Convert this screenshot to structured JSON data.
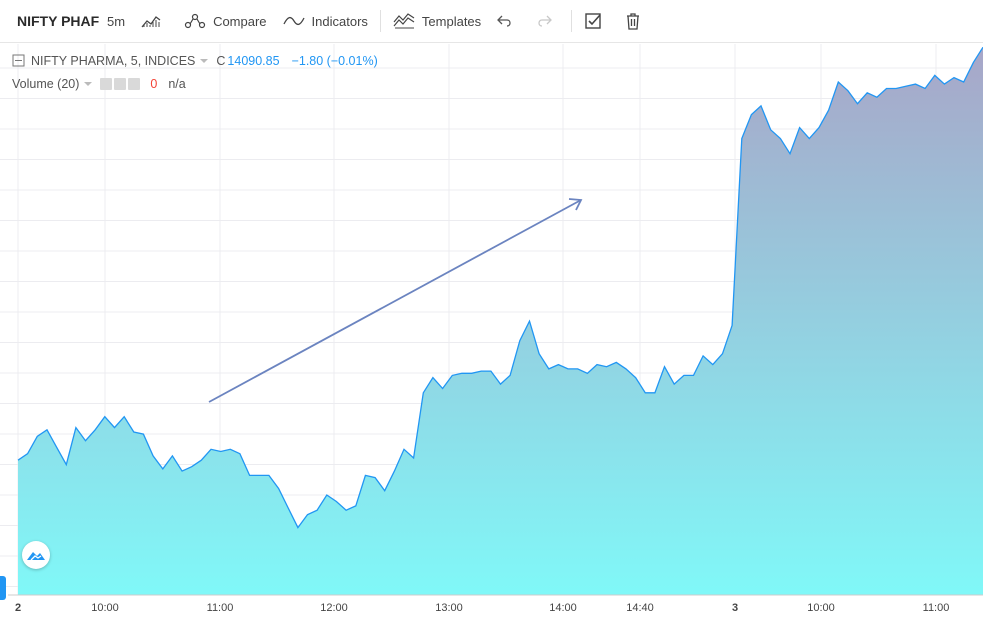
{
  "toolbar": {
    "symbol": "NIFTY PHAF",
    "interval": "5m",
    "compare_label": "Compare",
    "indicators_label": "Indicators",
    "templates_label": "Templates"
  },
  "legend": {
    "series_title": "NIFTY PHARMA, 5, INDICES",
    "close_prefix": "C",
    "close_value": "14090.85",
    "change": "−1.80 (−0.01%)",
    "volume_title": "Volume (20)",
    "volume_value": "0",
    "volume_na": "n/a"
  },
  "colors": {
    "line": "#2196f3",
    "area_top": "#a8a6c8",
    "area_bottom": "#80f8f8",
    "arrow": "#6b84c0",
    "accent": "#2196f3"
  },
  "chart_data": {
    "type": "area",
    "x_tick_labels": [
      "2",
      "10:00",
      "11:00",
      "12:00",
      "13:00",
      "14:00",
      "14:40",
      "3",
      "10:00",
      "11:00"
    ],
    "values": [
      14029,
      14032,
      14040,
      14043,
      14035,
      14027,
      14044,
      14038,
      14043,
      14049,
      14044,
      14049,
      14042,
      14041,
      14031,
      14025,
      14031,
      14024,
      14026,
      14029,
      14034,
      14033,
      14034,
      14032,
      14022,
      14022,
      14022,
      14016,
      14007,
      13998,
      14004,
      14006,
      14013,
      14010,
      14006,
      14008,
      14022,
      14021,
      14015,
      14024,
      14034,
      14030,
      14060,
      14067,
      14062,
      14068,
      14069,
      14069,
      14070,
      14070,
      14064,
      14068,
      14084,
      14093,
      14078,
      14071,
      14073,
      14071,
      14071,
      14069,
      14073,
      14072,
      14074,
      14071,
      14067,
      14060,
      14060,
      14072,
      14064,
      14068,
      14068,
      14077,
      14073,
      14078,
      14091,
      14177,
      14188,
      14192,
      14181,
      14177,
      14170,
      14182,
      14177,
      14182,
      14190,
      14203,
      14199,
      14193,
      14198,
      14196,
      14200,
      14200,
      14201,
      14202,
      14200,
      14206,
      14202,
      14205,
      14203,
      14212,
      14219
    ],
    "ylim": [
      13990,
      14220
    ],
    "grid": true
  }
}
